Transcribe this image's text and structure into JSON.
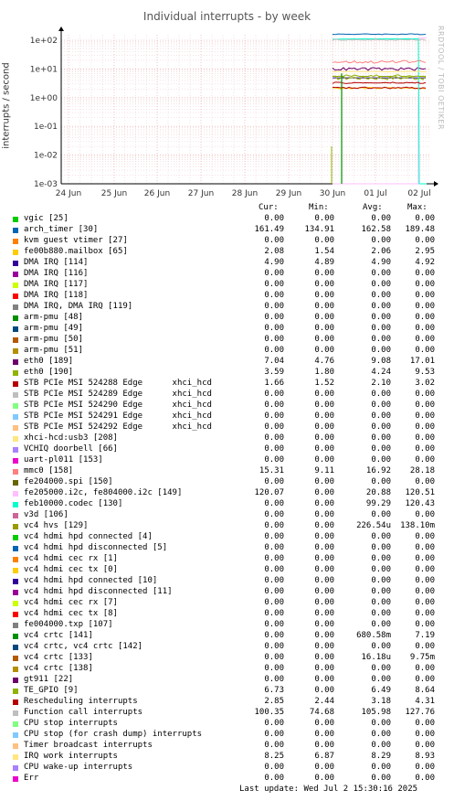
{
  "title": "Individual interrupts - by week",
  "ylabel": "interrupts / second",
  "watermark": "RRDTOOL / TOBI OETIKER",
  "columns": {
    "cur": "Cur:",
    "min": "Min:",
    "avg": "Avg:",
    "max": "Max:"
  },
  "footer": "Last update: Wed Jul  2 15:30:16 2025",
  "chart_data": {
    "type": "line",
    "title": "Individual interrupts - by week",
    "ylabel": "interrupts / second",
    "y_scale": "log",
    "ylim": [
      0.001,
      300
    ],
    "y_ticks": [
      "1e+02",
      "1e+01",
      "1e+00",
      "1e-01",
      "1e-02",
      "1e-03"
    ],
    "x_ticks": [
      "24 Jun",
      "25 Jun",
      "26 Jun",
      "27 Jun",
      "28 Jun",
      "29 Jun",
      "30 Jun",
      "01 Jul",
      "02 Jul"
    ],
    "grid": true,
    "series": [
      {
        "name": "vgic [25]",
        "color": "#00cc00",
        "cur": "0.00",
        "min": "0.00",
        "avg": "0.00",
        "max": "0.00"
      },
      {
        "name": "arch_timer [30]",
        "color": "#0066b3",
        "cur": "161.49",
        "min": "134.91",
        "avg": "162.58",
        "max": "189.48"
      },
      {
        "name": "kvm guest vtimer [27]",
        "color": "#ff8000",
        "cur": "0.00",
        "min": "0.00",
        "avg": "0.00",
        "max": "0.00"
      },
      {
        "name": "fe00b880.mailbox [65]",
        "color": "#ffcc00",
        "cur": "2.08",
        "min": "1.54",
        "avg": "2.06",
        "max": "2.95"
      },
      {
        "name": "DMA IRQ [114]",
        "color": "#330099",
        "cur": "4.90",
        "min": "4.89",
        "avg": "4.90",
        "max": "4.92"
      },
      {
        "name": "DMA IRQ [116]",
        "color": "#990099",
        "cur": "0.00",
        "min": "0.00",
        "avg": "0.00",
        "max": "0.00"
      },
      {
        "name": "DMA IRQ [117]",
        "color": "#ccff00",
        "cur": "0.00",
        "min": "0.00",
        "avg": "0.00",
        "max": "0.00"
      },
      {
        "name": "DMA IRQ [118]",
        "color": "#ff0000",
        "cur": "0.00",
        "min": "0.00",
        "avg": "0.00",
        "max": "0.00"
      },
      {
        "name": "DMA IRQ, DMA IRQ [119]",
        "color": "#808080",
        "cur": "0.00",
        "min": "0.00",
        "avg": "0.00",
        "max": "0.00"
      },
      {
        "name": "arm-pmu [48]",
        "color": "#008f00",
        "cur": "0.00",
        "min": "0.00",
        "avg": "0.00",
        "max": "0.00"
      },
      {
        "name": "arm-pmu [49]",
        "color": "#00487d",
        "cur": "0.00",
        "min": "0.00",
        "avg": "0.00",
        "max": "0.00"
      },
      {
        "name": "arm-pmu [50]",
        "color": "#b35a00",
        "cur": "0.00",
        "min": "0.00",
        "avg": "0.00",
        "max": "0.00"
      },
      {
        "name": "arm-pmu [51]",
        "color": "#b38f00",
        "cur": "0.00",
        "min": "0.00",
        "avg": "0.00",
        "max": "0.00"
      },
      {
        "name": "eth0 [189]",
        "color": "#6b006b",
        "cur": "7.04",
        "min": "4.76",
        "avg": "9.08",
        "max": "17.01"
      },
      {
        "name": "eth0 [190]",
        "color": "#8fb300",
        "cur": "3.59",
        "min": "1.80",
        "avg": "4.24",
        "max": "9.53"
      },
      {
        "name": "STB PCIe MSI 524288 Edge      xhci_hcd",
        "color": "#b30000",
        "cur": "1.66",
        "min": "1.52",
        "avg": "2.10",
        "max": "3.02"
      },
      {
        "name": "STB PCIe MSI 524289 Edge      xhci_hcd",
        "color": "#bebebe",
        "cur": "0.00",
        "min": "0.00",
        "avg": "0.00",
        "max": "0.00"
      },
      {
        "name": "STB PCIe MSI 524290 Edge      xhci_hcd",
        "color": "#80ff80",
        "cur": "0.00",
        "min": "0.00",
        "avg": "0.00",
        "max": "0.00"
      },
      {
        "name": "STB PCIe MSI 524291 Edge      xhci_hcd",
        "color": "#80c9ff",
        "cur": "0.00",
        "min": "0.00",
        "avg": "0.00",
        "max": "0.00"
      },
      {
        "name": "STB PCIe MSI 524292 Edge      xhci_hcd",
        "color": "#ffc080",
        "cur": "0.00",
        "min": "0.00",
        "avg": "0.00",
        "max": "0.00"
      },
      {
        "name": "xhci-hcd:usb3 [208]",
        "color": "#ffe680",
        "cur": "0.00",
        "min": "0.00",
        "avg": "0.00",
        "max": "0.00"
      },
      {
        "name": "VCHIQ doorbell [66]",
        "color": "#aa80ff",
        "cur": "0.00",
        "min": "0.00",
        "avg": "0.00",
        "max": "0.00"
      },
      {
        "name": "uart-pl011 [153]",
        "color": "#ee00cc",
        "cur": "0.00",
        "min": "0.00",
        "avg": "0.00",
        "max": "0.00"
      },
      {
        "name": "mmc0 [158]",
        "color": "#ff8080",
        "cur": "15.31",
        "min": "9.11",
        "avg": "16.92",
        "max": "28.18"
      },
      {
        "name": "fe204000.spi [150]",
        "color": "#666600",
        "cur": "0.00",
        "min": "0.00",
        "avg": "0.00",
        "max": "0.00"
      },
      {
        "name": "fe205000.i2c, fe804000.i2c [149]",
        "color": "#ffbfff",
        "cur": "120.07",
        "min": "0.00",
        "avg": "20.88",
        "max": "120.51"
      },
      {
        "name": "feb10000.codec [130]",
        "color": "#00ffcc",
        "cur": "0.00",
        "min": "0.00",
        "avg": "99.29",
        "max": "120.43"
      },
      {
        "name": "v3d [106]",
        "color": "#cc6699",
        "cur": "0.00",
        "min": "0.00",
        "avg": "0.00",
        "max": "0.00"
      },
      {
        "name": "vc4 hvs [129]",
        "color": "#999900",
        "cur": "0.00",
        "min": "0.00",
        "avg": "226.54u",
        "max": "138.10m"
      },
      {
        "name": "vc4 hdmi hpd connected [4]",
        "color": "#00cc00",
        "cur": "0.00",
        "min": "0.00",
        "avg": "0.00",
        "max": "0.00"
      },
      {
        "name": "vc4 hdmi hpd disconnected [5]",
        "color": "#0066b3",
        "cur": "0.00",
        "min": "0.00",
        "avg": "0.00",
        "max": "0.00"
      },
      {
        "name": "vc4 hdmi cec rx [1]",
        "color": "#ff8000",
        "cur": "0.00",
        "min": "0.00",
        "avg": "0.00",
        "max": "0.00"
      },
      {
        "name": "vc4 hdmi cec tx [0]",
        "color": "#ffcc00",
        "cur": "0.00",
        "min": "0.00",
        "avg": "0.00",
        "max": "0.00"
      },
      {
        "name": "vc4 hdmi hpd connected [10]",
        "color": "#330099",
        "cur": "0.00",
        "min": "0.00",
        "avg": "0.00",
        "max": "0.00"
      },
      {
        "name": "vc4 hdmi hpd disconnected [11]",
        "color": "#990099",
        "cur": "0.00",
        "min": "0.00",
        "avg": "0.00",
        "max": "0.00"
      },
      {
        "name": "vc4 hdmi cec rx [7]",
        "color": "#ccff00",
        "cur": "0.00",
        "min": "0.00",
        "avg": "0.00",
        "max": "0.00"
      },
      {
        "name": "vc4 hdmi cec tx [8]",
        "color": "#ff0000",
        "cur": "0.00",
        "min": "0.00",
        "avg": "0.00",
        "max": "0.00"
      },
      {
        "name": "fe004000.txp [107]",
        "color": "#808080",
        "cur": "0.00",
        "min": "0.00",
        "avg": "0.00",
        "max": "0.00"
      },
      {
        "name": "vc4 crtc [141]",
        "color": "#008f00",
        "cur": "0.00",
        "min": "0.00",
        "avg": "680.58m",
        "max": "7.19"
      },
      {
        "name": "vc4 crtc, vc4 crtc [142]",
        "color": "#00487d",
        "cur": "0.00",
        "min": "0.00",
        "avg": "0.00",
        "max": "0.00"
      },
      {
        "name": "vc4 crtc [133]",
        "color": "#b35a00",
        "cur": "0.00",
        "min": "0.00",
        "avg": "16.18u",
        "max": "9.75m"
      },
      {
        "name": "vc4 crtc [138]",
        "color": "#b38f00",
        "cur": "0.00",
        "min": "0.00",
        "avg": "0.00",
        "max": "0.00"
      },
      {
        "name": "gt911 [22]",
        "color": "#6b006b",
        "cur": "0.00",
        "min": "0.00",
        "avg": "0.00",
        "max": "0.00"
      },
      {
        "name": "TE_GPIO [9]",
        "color": "#8fb300",
        "cur": "6.73",
        "min": "0.00",
        "avg": "6.49",
        "max": "8.64"
      },
      {
        "name": "Rescheduling interrupts",
        "color": "#b30000",
        "cur": "2.85",
        "min": "2.44",
        "avg": "3.18",
        "max": "4.31"
      },
      {
        "name": "Function call interrupts",
        "color": "#bebebe",
        "cur": "100.35",
        "min": "74.68",
        "avg": "105.98",
        "max": "127.76"
      },
      {
        "name": "CPU stop interrupts",
        "color": "#80ff80",
        "cur": "0.00",
        "min": "0.00",
        "avg": "0.00",
        "max": "0.00"
      },
      {
        "name": "CPU stop (for crash dump) interrupts",
        "color": "#80c9ff",
        "cur": "0.00",
        "min": "0.00",
        "avg": "0.00",
        "max": "0.00"
      },
      {
        "name": "Timer broadcast interrupts",
        "color": "#ffc080",
        "cur": "0.00",
        "min": "0.00",
        "avg": "0.00",
        "max": "0.00"
      },
      {
        "name": "IRQ work interrupts",
        "color": "#ffe680",
        "cur": "8.25",
        "min": "6.87",
        "avg": "8.29",
        "max": "8.93"
      },
      {
        "name": "CPU wake-up interrupts",
        "color": "#aa80ff",
        "cur": "0.00",
        "min": "0.00",
        "avg": "0.00",
        "max": "0.00"
      },
      {
        "name": "Err",
        "color": "#ee00cc",
        "cur": "0.00",
        "min": "0.00",
        "avg": "0.00",
        "max": "0.00"
      }
    ]
  }
}
